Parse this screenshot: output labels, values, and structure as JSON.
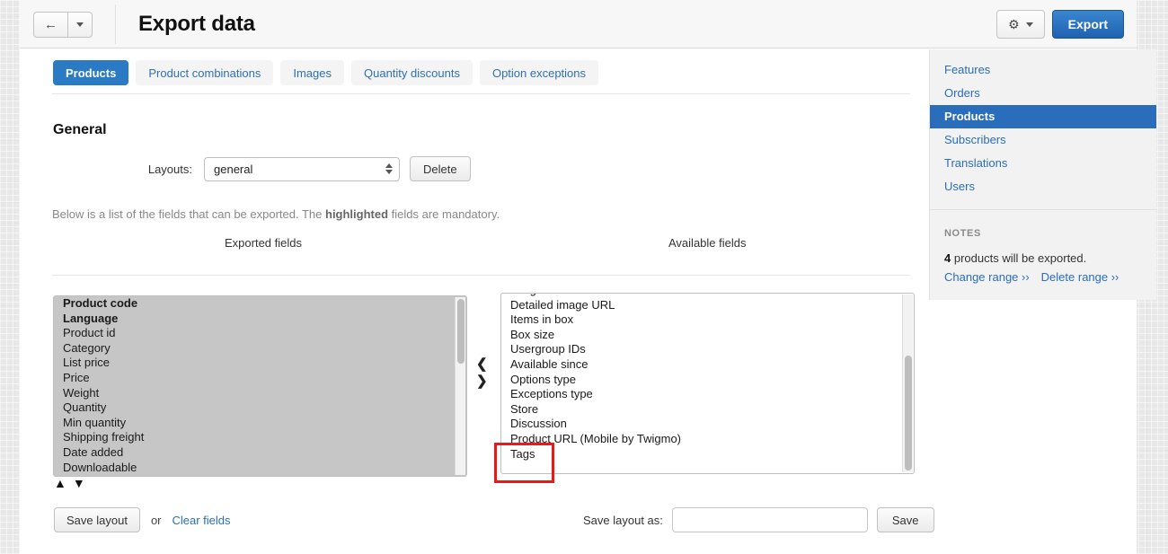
{
  "header": {
    "title": "Export data",
    "back_icon": "arrow-left-icon",
    "caret_icon": "chevron-down-icon",
    "gear_icon": "gear-icon",
    "gear_caret_icon": "chevron-down-icon",
    "export_label": "Export",
    "accent_blue": "#2a7ac4"
  },
  "tabs": [
    {
      "label": "Products",
      "active": true
    },
    {
      "label": "Product combinations",
      "active": false
    },
    {
      "label": "Images",
      "active": false
    },
    {
      "label": "Quantity discounts",
      "active": false
    },
    {
      "label": "Option exceptions",
      "active": false
    }
  ],
  "main": {
    "section_title": "General",
    "layouts_label": "Layouts:",
    "layouts_value": "general",
    "layouts_spinner_icon": "updown-spinner-icon",
    "delete_label": "Delete",
    "hint_prefix": "Below is a list of the fields that can be exported. The ",
    "hint_bold": "highlighted",
    "hint_suffix": " fields are mandatory.",
    "exported_head": "Exported fields",
    "available_head": "Available fields",
    "move_left_icon": "chevron-left-icon",
    "move_right_icon": "chevron-right-icon",
    "sort_up_icon": "caret-up-icon",
    "sort_down_icon": "caret-down-icon",
    "save_layout_label": "Save layout",
    "or_label": "or",
    "clear_fields_label": "Clear fields",
    "save_layout_as_label": "Save layout as:",
    "save_layout_as_value": "",
    "save_layout_as_placeholder": "",
    "save_label": "Save"
  },
  "exported_fields": [
    {
      "label": "Product code",
      "mandatory": true
    },
    {
      "label": "Language",
      "mandatory": true
    },
    {
      "label": "Product id",
      "mandatory": false
    },
    {
      "label": "Category",
      "mandatory": false
    },
    {
      "label": "List price",
      "mandatory": false
    },
    {
      "label": "Price",
      "mandatory": false
    },
    {
      "label": "Weight",
      "mandatory": false
    },
    {
      "label": "Quantity",
      "mandatory": false
    },
    {
      "label": "Min quantity",
      "mandatory": false
    },
    {
      "label": "Shipping freight",
      "mandatory": false
    },
    {
      "label": "Date added",
      "mandatory": false
    },
    {
      "label": "Downloadable",
      "mandatory": false
    }
  ],
  "available_fields": [
    {
      "label": "Image URL"
    },
    {
      "label": "Detailed image URL"
    },
    {
      "label": "Items in box"
    },
    {
      "label": "Box size"
    },
    {
      "label": "Usergroup IDs"
    },
    {
      "label": "Available since"
    },
    {
      "label": "Options type"
    },
    {
      "label": "Exceptions type"
    },
    {
      "label": "Store"
    },
    {
      "label": "Discussion"
    },
    {
      "label": "Product URL (Mobile by Twigmo)"
    },
    {
      "label": "Tags"
    }
  ],
  "sidebar": {
    "items": [
      {
        "label": "Features",
        "active": false
      },
      {
        "label": "Orders",
        "active": false
      },
      {
        "label": "Products",
        "active": true
      },
      {
        "label": "Subscribers",
        "active": false
      },
      {
        "label": "Translations",
        "active": false
      },
      {
        "label": "Users",
        "active": false
      }
    ],
    "notes_title": "NOTES",
    "notes_count": "4",
    "notes_text": " products will be exported.",
    "change_range": "Change range ››",
    "delete_range": "Delete range ››"
  },
  "annotation": {
    "target": "Tags",
    "color": "#e8191a"
  }
}
